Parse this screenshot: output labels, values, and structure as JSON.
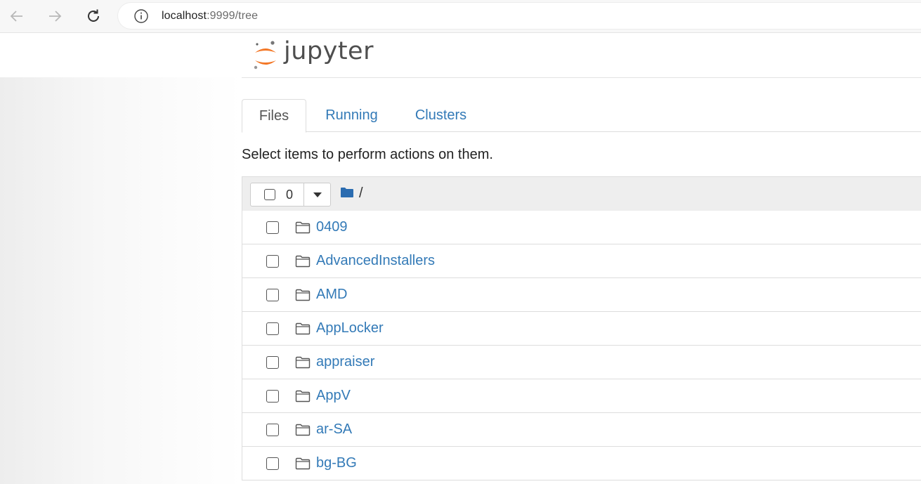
{
  "browser": {
    "url_host": "localhost",
    "url_rest": ":9999/tree"
  },
  "header": {
    "logo_text": "jupyter"
  },
  "tabs": [
    {
      "label": "Files"
    },
    {
      "label": "Running"
    },
    {
      "label": "Clusters"
    }
  ],
  "instructions": "Select items to perform actions on them.",
  "toolbar": {
    "selected_count": "0",
    "breadcrumb": "/"
  },
  "files": [
    {
      "name": "0409"
    },
    {
      "name": "AdvancedInstallers"
    },
    {
      "name": "AMD"
    },
    {
      "name": "AppLocker"
    },
    {
      "name": "appraiser"
    },
    {
      "name": "AppV"
    },
    {
      "name": "ar-SA"
    },
    {
      "name": "bg-BG"
    }
  ],
  "colors": {
    "link": "#337ab7",
    "logo_orange": "#f37726"
  }
}
